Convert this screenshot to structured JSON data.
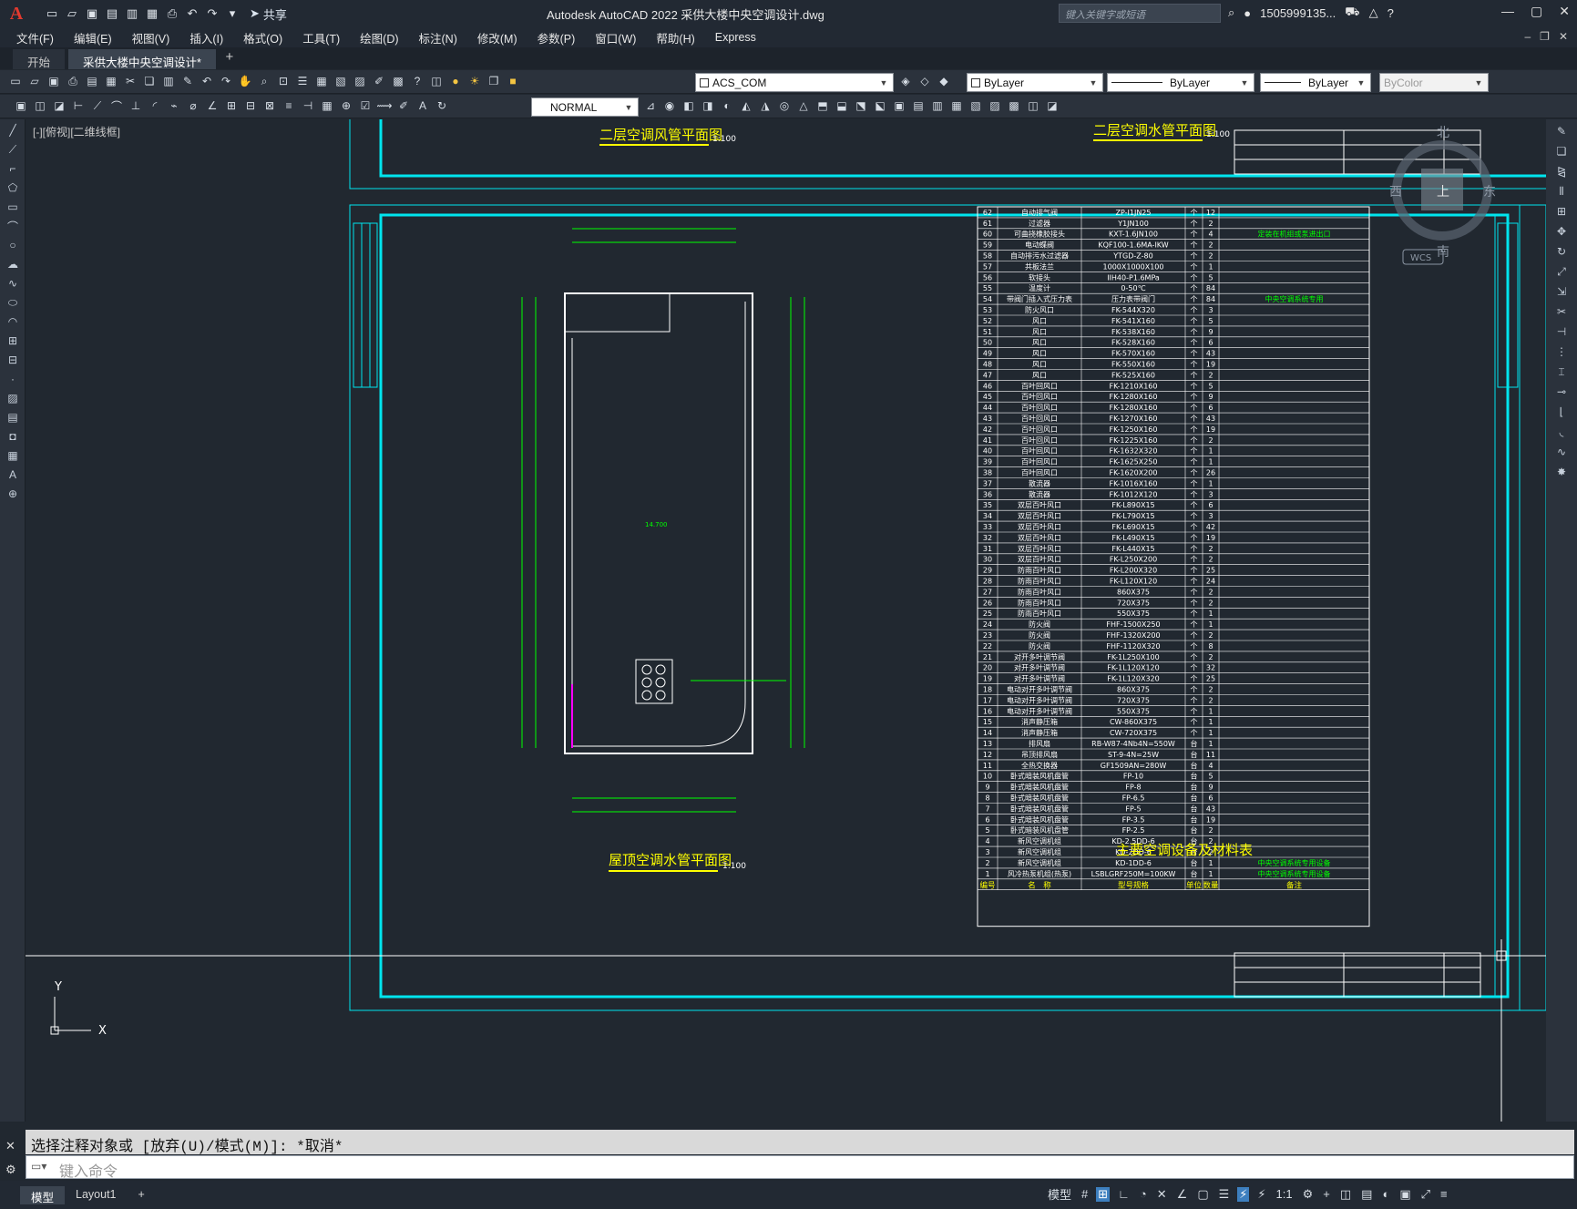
{
  "app": {
    "logo": "A",
    "title": "Autodesk AutoCAD 2022    采供大楼中央空调设计.dwg",
    "share_label": "共享",
    "search_placeholder": "键入关键字或短语",
    "user": "1505999135...",
    "window_controls": [
      "minimize-icon",
      "restore-icon",
      "close-icon"
    ]
  },
  "menu": [
    "文件(F)",
    "编辑(E)",
    "视图(V)",
    "插入(I)",
    "格式(O)",
    "工具(T)",
    "绘图(D)",
    "标注(N)",
    "修改(M)",
    "参数(P)",
    "窗口(W)",
    "帮助(H)",
    "Express"
  ],
  "tabs": [
    {
      "label": "开始",
      "active": false
    },
    {
      "label": "采供大楼中央空调设计*",
      "active": true
    }
  ],
  "toolbar": {
    "layer": "ACS_COM",
    "color": "ByLayer",
    "linetype": "ByLayer",
    "lineweight": "ByLayer",
    "plotstyle": "ByColor",
    "textstyle": "NORMAL"
  },
  "canvas": {
    "viewport_label": "[-][俯视][二维线框]",
    "viewcube": {
      "north": "北",
      "south": "南",
      "east": "东",
      "west": "西",
      "top": "上",
      "wcs": "WCS"
    },
    "ucs": {
      "y": "Y",
      "x": "X"
    }
  },
  "drawing": {
    "titles": {
      "air_duct_2f": "二层空调风管平面图",
      "water_pipe_2f": "二层空调水管平面图",
      "roof_water_pipe": "屋顶空调水管平面图",
      "scale": "1:100",
      "table_title": "主要空调设备及材料表"
    },
    "table": {
      "headers": [
        "编号",
        "名　称",
        "型号规格",
        "单位",
        "数量",
        "备注"
      ],
      "rows": [
        [
          "62",
          "自动排气阀",
          "ZP-I1JN25",
          "个",
          "12",
          ""
        ],
        [
          "61",
          "过滤器",
          "Y1JN100",
          "个",
          "2",
          ""
        ],
        [
          "60",
          "可曲挠橡胶接头",
          "KXT-1.6JN100",
          "个",
          "4",
          "定装在机组或泵进出口"
        ],
        [
          "59",
          "电动蝶阀",
          "KQF100-1.6MA-IKW",
          "个",
          "2",
          ""
        ],
        [
          "58",
          "自动排污水过滤器",
          "YTGD-Z-80",
          "个",
          "2",
          ""
        ],
        [
          "57",
          "共板法兰",
          "1000X1000X100",
          "个",
          "1",
          ""
        ],
        [
          "56",
          "软接头",
          "IIH40-P1.6MPa",
          "个",
          "5",
          ""
        ],
        [
          "55",
          "温度计",
          "0-50℃",
          "个",
          "84",
          ""
        ],
        [
          "54",
          "带阀门插入式压力表",
          "压力表带阀门",
          "个",
          "84",
          "中央空调系统专用"
        ],
        [
          "53",
          "防火风口",
          "FK-544X320",
          "个",
          "3",
          ""
        ],
        [
          "52",
          "风口",
          "FK-541X160",
          "个",
          "5",
          ""
        ],
        [
          "51",
          "风口",
          "FK-538X160",
          "个",
          "9",
          ""
        ],
        [
          "50",
          "风口",
          "FK-528X160",
          "个",
          "6",
          ""
        ],
        [
          "49",
          "风口",
          "FK-570X160",
          "个",
          "43",
          ""
        ],
        [
          "48",
          "风口",
          "FK-550X160",
          "个",
          "19",
          ""
        ],
        [
          "47",
          "风口",
          "FK-525X160",
          "个",
          "2",
          ""
        ],
        [
          "46",
          "百叶回风口",
          "FK-1210X160",
          "个",
          "5",
          ""
        ],
        [
          "45",
          "百叶回风口",
          "FK-1280X160",
          "个",
          "9",
          ""
        ],
        [
          "44",
          "百叶回风口",
          "FK-1280X160",
          "个",
          "6",
          ""
        ],
        [
          "43",
          "百叶回风口",
          "FK-1270X160",
          "个",
          "43",
          ""
        ],
        [
          "42",
          "百叶回风口",
          "FK-1250X160",
          "个",
          "19",
          ""
        ],
        [
          "41",
          "百叶回风口",
          "FK-1225X160",
          "个",
          "2",
          ""
        ],
        [
          "40",
          "百叶回风口",
          "FK-1632X320",
          "个",
          "1",
          ""
        ],
        [
          "39",
          "百叶回风口",
          "FK-1625X250",
          "个",
          "1",
          ""
        ],
        [
          "38",
          "百叶回风口",
          "FK-1620X200",
          "个",
          "26",
          ""
        ],
        [
          "37",
          "散流器",
          "FK-1016X160",
          "个",
          "1",
          ""
        ],
        [
          "36",
          "散流器",
          "FK-1012X120",
          "个",
          "3",
          ""
        ],
        [
          "35",
          "双层百叶风口",
          "FK-L890X15",
          "个",
          "6",
          ""
        ],
        [
          "34",
          "双层百叶风口",
          "FK-L790X15",
          "个",
          "3",
          ""
        ],
        [
          "33",
          "双层百叶风口",
          "FK-L690X15",
          "个",
          "42",
          ""
        ],
        [
          "32",
          "双层百叶风口",
          "FK-L490X15",
          "个",
          "19",
          ""
        ],
        [
          "31",
          "双层百叶风口",
          "FK-L440X15",
          "个",
          "2",
          ""
        ],
        [
          "30",
          "双层百叶风口",
          "FK-L250X200",
          "个",
          "2",
          ""
        ],
        [
          "29",
          "防雨百叶风口",
          "FK-L200X320",
          "个",
          "25",
          ""
        ],
        [
          "28",
          "防雨百叶风口",
          "FK-L120X120",
          "个",
          "24",
          ""
        ],
        [
          "27",
          "防雨百叶风口",
          "860X375",
          "个",
          "2",
          ""
        ],
        [
          "26",
          "防雨百叶风口",
          "720X375",
          "个",
          "2",
          ""
        ],
        [
          "25",
          "防雨百叶风口",
          "550X375",
          "个",
          "1",
          ""
        ],
        [
          "24",
          "防火阀",
          "FHF-1500X250",
          "个",
          "1",
          ""
        ],
        [
          "23",
          "防火阀",
          "FHF-1320X200",
          "个",
          "2",
          ""
        ],
        [
          "22",
          "防火阀",
          "FHF-1120X320",
          "个",
          "8",
          ""
        ],
        [
          "21",
          "对开多叶调节阀",
          "FK-1L250X100",
          "个",
          "2",
          ""
        ],
        [
          "20",
          "对开多叶调节阀",
          "FK-1L120X120",
          "个",
          "32",
          ""
        ],
        [
          "19",
          "对开多叶调节阀",
          "FK-1L120X320",
          "个",
          "25",
          ""
        ],
        [
          "18",
          "电动对开多叶调节阀",
          "860X375",
          "个",
          "2",
          ""
        ],
        [
          "17",
          "电动对开多叶调节阀",
          "720X375",
          "个",
          "2",
          ""
        ],
        [
          "16",
          "电动对开多叶调节阀",
          "550X375",
          "个",
          "1",
          ""
        ],
        [
          "15",
          "消声静压箱",
          "CW-860X375",
          "个",
          "1",
          ""
        ],
        [
          "14",
          "消声静压箱",
          "CW-720X375",
          "个",
          "1",
          ""
        ],
        [
          "13",
          "排风扇",
          "RB-W87-4Nb4N=550W",
          "台",
          "1",
          ""
        ],
        [
          "12",
          "吊顶排风扇",
          "ST-9-4N=25W",
          "台",
          "11",
          ""
        ],
        [
          "11",
          "全热交换器",
          "GF1509AN=280W",
          "台",
          "4",
          ""
        ],
        [
          "10",
          "卧式暗装风机盘管",
          "FP-10",
          "台",
          "5",
          ""
        ],
        [
          "9",
          "卧式暗装风机盘管",
          "FP-8",
          "台",
          "9",
          ""
        ],
        [
          "8",
          "卧式暗装风机盘管",
          "FP-6.5",
          "台",
          "6",
          ""
        ],
        [
          "7",
          "卧式暗装风机盘管",
          "FP-5",
          "台",
          "43",
          ""
        ],
        [
          "6",
          "卧式暗装风机盘管",
          "FP-3.5",
          "台",
          "19",
          ""
        ],
        [
          "5",
          "卧式暗装风机盘管",
          "FP-2.5",
          "台",
          "2",
          ""
        ],
        [
          "4",
          "新风空调机组",
          "KD-2.5DD-6",
          "台",
          "2",
          ""
        ],
        [
          "3",
          "新风空调机组",
          "KD-2DD-6",
          "台",
          "2",
          ""
        ],
        [
          "2",
          "新风空调机组",
          "KD-1DD-6",
          "台",
          "1",
          "中央空调系统专用设备"
        ],
        [
          "1",
          "风冷热泵机组(热泵)",
          "LSBLGRF250M=100KW",
          "台",
          "1",
          "中央空调系统专用设备"
        ]
      ]
    }
  },
  "command": {
    "history": "选择注释对象或 [放弃(U)/模式(M)]: *取消*",
    "placeholder": "键入命令"
  },
  "status": {
    "layout_tabs": [
      {
        "label": "模型",
        "active": true
      },
      {
        "label": "Layout1",
        "active": false
      }
    ],
    "model_label": "模型",
    "scale": "1:1"
  }
}
